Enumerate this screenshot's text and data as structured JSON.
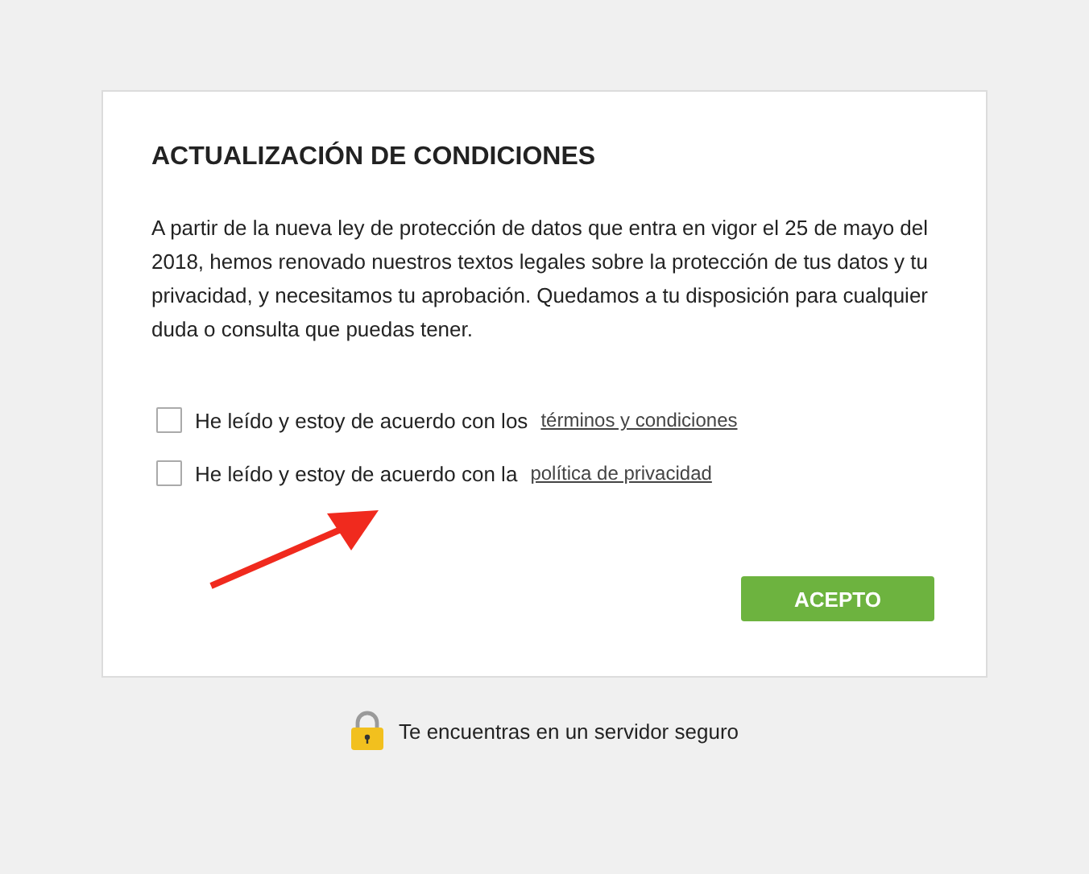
{
  "dialog": {
    "title": "ACTUALIZACIÓN DE CONDICIONES",
    "body": "A partir de la nueva ley de protección de datos que entra en vigor el 25 de mayo del 2018, hemos renovado nuestros textos legales sobre la protección de tus datos y tu privacidad, y necesitamos tu aprobación. Quedamos a tu disposición para cualquier duda o consulta que puedas tener.",
    "consents": [
      {
        "label": "He leído y estoy de acuerdo con los",
        "link": "términos y condiciones",
        "checked": false
      },
      {
        "label": "He leído y estoy de acuerdo con la",
        "link": "política de privacidad",
        "checked": false
      }
    ],
    "button": "ACEPTO"
  },
  "footer": {
    "text": "Te encuentras en un servidor seguro"
  }
}
